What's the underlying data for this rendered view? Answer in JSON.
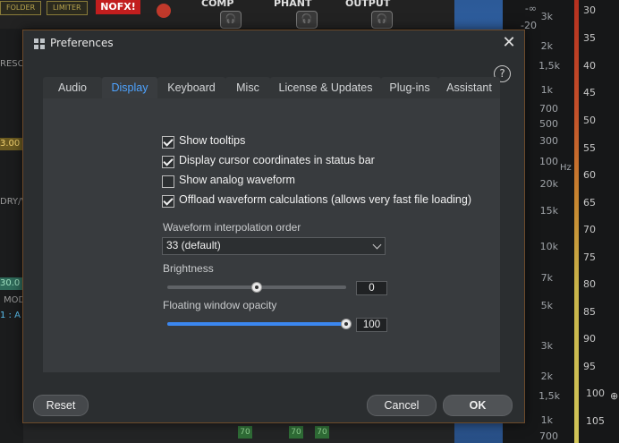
{
  "background": {
    "tags": [
      "FOLDER",
      "LIMITER"
    ],
    "nofx": "NOFX!",
    "headers": [
      "COMP",
      "PHANT",
      "OUTPUT"
    ],
    "left_texts": [
      "RESC",
      "3.00",
      "DRY/V",
      "30.0",
      "MOD",
      "1 : A"
    ],
    "meter_values": [
      "70",
      "70",
      "70"
    ],
    "freq_labels": [
      "-∞",
      "-20",
      "3k",
      "2k",
      "1,5k",
      "1k",
      "700",
      "500",
      "300",
      "100",
      "20k",
      "15k",
      "10k",
      "7k",
      "5k",
      "3k",
      "2k",
      "1,5k",
      "1k",
      "700"
    ],
    "hz_label": "Hz",
    "db_labels": [
      "30",
      "35",
      "40",
      "45",
      "50",
      "55",
      "60",
      "65",
      "70",
      "75",
      "80",
      "85",
      "90",
      "95",
      "100",
      "105"
    ]
  },
  "dialog": {
    "title": "Preferences",
    "close": "✕",
    "help": "?",
    "tabs": [
      {
        "label": "Audio",
        "active": false
      },
      {
        "label": "Display",
        "active": true
      },
      {
        "label": "Keyboard",
        "active": false
      },
      {
        "label": "Misc",
        "active": false
      },
      {
        "label": "License & Updates",
        "active": false
      },
      {
        "label": "Plug-ins",
        "active": false
      },
      {
        "label": "Assistant",
        "active": false
      }
    ],
    "checkboxes": [
      {
        "label": "Show tooltips",
        "checked": true
      },
      {
        "label": "Display cursor coordinates in status bar",
        "checked": true
      },
      {
        "label": "Show analog waveform",
        "checked": false
      },
      {
        "label": "Offload waveform calculations (allows very fast file loading)",
        "checked": true
      }
    ],
    "interpolation": {
      "label": "Waveform interpolation order",
      "value": "33 (default)"
    },
    "brightness": {
      "label": "Brightness",
      "value": "0",
      "fraction": 0.5
    },
    "opacity": {
      "label": "Floating window opacity",
      "value": "100",
      "fraction": 1.0
    },
    "buttons": {
      "reset": "Reset",
      "cancel": "Cancel",
      "ok": "OK"
    },
    "colors": {
      "accent": "#4ea3ff",
      "slider_fill": "#3b87f0",
      "border": "#6d4a2a"
    }
  }
}
